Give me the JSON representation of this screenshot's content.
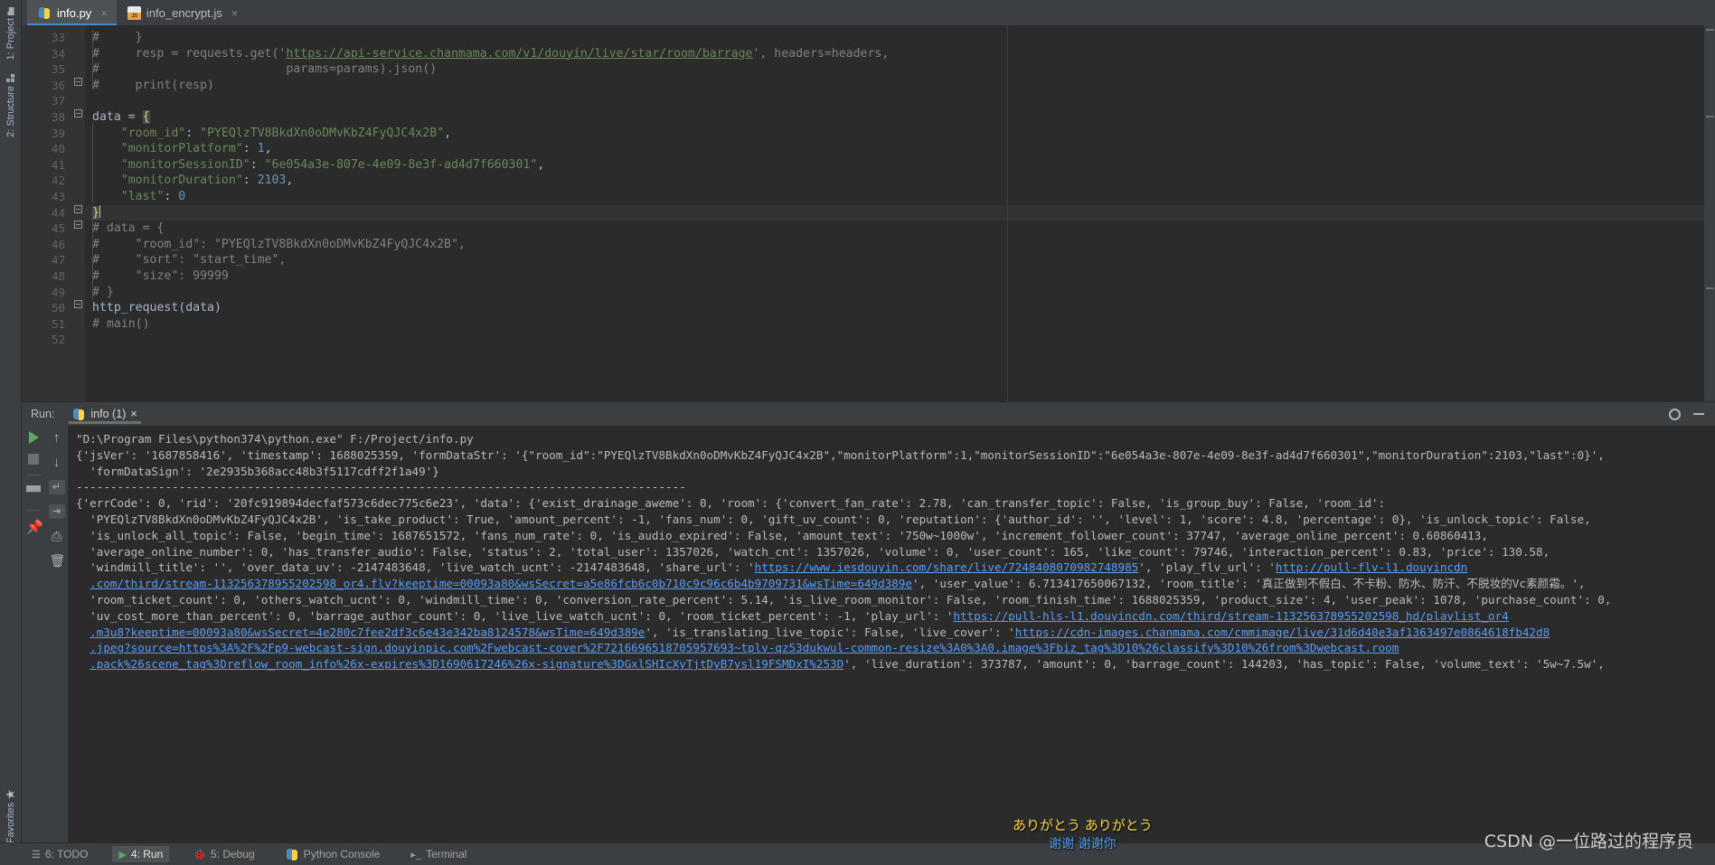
{
  "tabs": [
    {
      "label": "info.py",
      "icon": "python-file-icon",
      "active": true,
      "close": "×"
    },
    {
      "label": "info_encrypt.js",
      "icon": "javascript-file-icon",
      "active": false,
      "close": "×"
    }
  ],
  "left_strip": {
    "project": "1: Project",
    "structure": "2: Structure",
    "favorites": "2: Favorites"
  },
  "editor": {
    "first_line_number": 33,
    "lines": [
      {
        "n": 33,
        "segs": [
          {
            "t": "#     }",
            "c": "cmt"
          }
        ]
      },
      {
        "n": 34,
        "segs": [
          {
            "t": "#     resp = requests.get('",
            "c": "cmt"
          },
          {
            "t": "https://api-service.chanmama.com/v1/douyin/live/star/room/barrage",
            "c": "link"
          },
          {
            "t": "', headers=headers,",
            "c": "cmt"
          }
        ]
      },
      {
        "n": 35,
        "segs": [
          {
            "t": "#                          params=params).json()",
            "c": "cmt"
          }
        ]
      },
      {
        "n": 36,
        "segs": [
          {
            "t": "#     print(resp)",
            "c": "cmt"
          }
        ]
      },
      {
        "n": 37,
        "segs": [
          {
            "t": "",
            "c": "punc"
          }
        ]
      },
      {
        "n": 38,
        "segs": [
          {
            "t": "data = ",
            "c": "punc"
          },
          {
            "t": "{",
            "c": "brace-hl"
          }
        ]
      },
      {
        "n": 39,
        "segs": [
          {
            "t": "    ",
            "c": "punc"
          },
          {
            "t": "\"room_id\"",
            "c": "str"
          },
          {
            "t": ": ",
            "c": "punc"
          },
          {
            "t": "\"PYEQlzTV8BkdXn0oDMvKbZ4FyQJC4x2B\"",
            "c": "str"
          },
          {
            "t": ",",
            "c": "punc"
          }
        ]
      },
      {
        "n": 40,
        "segs": [
          {
            "t": "    ",
            "c": "punc"
          },
          {
            "t": "\"monitorPlatform\"",
            "c": "str"
          },
          {
            "t": ": ",
            "c": "punc"
          },
          {
            "t": "1",
            "c": "num"
          },
          {
            "t": ",",
            "c": "punc"
          }
        ]
      },
      {
        "n": 41,
        "segs": [
          {
            "t": "    ",
            "c": "punc"
          },
          {
            "t": "\"monitorSessionID\"",
            "c": "str"
          },
          {
            "t": ": ",
            "c": "punc"
          },
          {
            "t": "\"6e054a3e-807e-4e09-8e3f-ad4d7f660301\"",
            "c": "str"
          },
          {
            "t": ",",
            "c": "punc"
          }
        ]
      },
      {
        "n": 42,
        "segs": [
          {
            "t": "    ",
            "c": "punc"
          },
          {
            "t": "\"monitorDuration\"",
            "c": "str"
          },
          {
            "t": ": ",
            "c": "punc"
          },
          {
            "t": "2103",
            "c": "num"
          },
          {
            "t": ",",
            "c": "punc"
          }
        ]
      },
      {
        "n": 43,
        "segs": [
          {
            "t": "    ",
            "c": "punc"
          },
          {
            "t": "\"last\"",
            "c": "str"
          },
          {
            "t": ": ",
            "c": "punc"
          },
          {
            "t": "0",
            "c": "num"
          }
        ]
      },
      {
        "n": 44,
        "segs": [
          {
            "t": "}",
            "c": "brace-hl"
          }
        ],
        "cursor": true,
        "current": true
      },
      {
        "n": 45,
        "segs": [
          {
            "t": "# data = {",
            "c": "cmt"
          }
        ]
      },
      {
        "n": 46,
        "segs": [
          {
            "t": "#     \"room_id\": \"PYEQlzTV8BkdXn0oDMvKbZ4FyQJC4x2B\",",
            "c": "cmt"
          }
        ]
      },
      {
        "n": 47,
        "segs": [
          {
            "t": "#     \"sort\": \"start_time\",",
            "c": "cmt"
          }
        ]
      },
      {
        "n": 48,
        "segs": [
          {
            "t": "#     \"size\": 99999",
            "c": "cmt"
          }
        ]
      },
      {
        "n": 49,
        "segs": [
          {
            "t": "# }",
            "c": "cmt"
          }
        ]
      },
      {
        "n": 50,
        "segs": [
          {
            "t": "http_request(data)",
            "c": "punc"
          }
        ]
      },
      {
        "n": 51,
        "segs": [
          {
            "t": "# main()",
            "c": "cmt"
          }
        ]
      },
      {
        "n": 52,
        "segs": [
          {
            "t": "",
            "c": "punc"
          }
        ]
      }
    ]
  },
  "run_panel": {
    "run_label": "Run:",
    "tab_label": "info (1)",
    "tab_close": "×",
    "gear_icon": "settings-gear-icon",
    "minimize_icon": "minimize-icon",
    "toolbar_left": [
      {
        "name": "rerun-button",
        "glyph": ""
      },
      {
        "name": "stop-button",
        "glyph": ""
      },
      {
        "name": "layout-button",
        "glyph": ""
      },
      {
        "name": "pin-tab-button",
        "glyph": "📌"
      }
    ],
    "toolbar_right": [
      {
        "name": "up-arrow-button",
        "glyph": "↑"
      },
      {
        "name": "down-arrow-button",
        "glyph": "↓"
      },
      {
        "name": "soft-wrap-button",
        "glyph": "↵"
      },
      {
        "name": "scroll-to-end-button",
        "glyph": "⇥"
      },
      {
        "name": "print-button",
        "glyph": "⎙"
      },
      {
        "name": "clear-all-button",
        "glyph": "🗑"
      }
    ],
    "console_lines": [
      {
        "segs": [
          {
            "t": "\"D:\\Program Files\\python374\\python.exe\" F:/Project/info.py",
            "c": ""
          }
        ]
      },
      {
        "segs": [
          {
            "t": "{'jsVer': '1687858416', 'timestamp': 1688025359, 'formDataStr': '{\"room_id\":\"PYEQlzTV8BkdXn0oDMvKbZ4FyQJC4x2B\",\"monitorPlatform\":1,\"monitorSessionID\":\"6e054a3e-807e-4e09-8e3f-ad4d7f660301\",\"monitorDuration\":2103,\"last\":0}',",
            "c": ""
          }
        ]
      },
      {
        "segs": [
          {
            "t": "  'formDataSign': '2e2935b368acc48b3f5117cdff2f1a49'}",
            "c": ""
          }
        ]
      },
      {
        "segs": [
          {
            "t": "-----------------------------------------------------------------------------------------",
            "c": ""
          }
        ]
      },
      {
        "segs": [
          {
            "t": "{'errCode': 0, 'rid': '20fc919894decfaf573c6dec775c6e23', 'data': {'exist_drainage_aweme': 0, 'room': {'convert_fan_rate': 2.78, 'can_transfer_topic': False, 'is_group_buy': False, 'room_id':",
            "c": ""
          }
        ]
      },
      {
        "segs": [
          {
            "t": "  'PYEQlzTV8BkdXn0oDMvKbZ4FyQJC4x2B', 'is_take_product': True, 'amount_percent': -1, 'fans_num': 0, 'gift_uv_count': 0, 'reputation': {'author_id': '', 'level': 1, 'score': 4.8, 'percentage': 0}, 'is_unlock_topic': False,",
            "c": ""
          }
        ]
      },
      {
        "segs": [
          {
            "t": "  'is_unlock_all_topic': False, 'begin_time': 1687651572, 'fans_num_rate': 0, 'is_audio_expired': False, 'amount_text': '750w~1000w', 'increment_follower_count': 37747, 'average_online_percent': 0.60860413,",
            "c": ""
          }
        ]
      },
      {
        "segs": [
          {
            "t": "  'average_online_number': 0, 'has_transfer_audio': False, 'status': 2, 'total_user': 1357026, 'watch_cnt': 1357026, 'volume': 0, 'user_count': 165, 'like_count': 79746, 'interaction_percent': 0.83, 'price': 130.58,",
            "c": ""
          }
        ]
      },
      {
        "segs": [
          {
            "t": "  'windmill_title': '', 'over_data_uv': -2147483648, 'live_watch_ucnt': -2147483648, 'share_url': '",
            "c": ""
          },
          {
            "t": "https://www.iesdouyin.com/share/live/7248408070982748985",
            "c": "ulink"
          },
          {
            "t": "', 'play_flv_url': '",
            "c": ""
          },
          {
            "t": "http://pull-flv-l1.douyincdn",
            "c": "ulink"
          }
        ]
      },
      {
        "segs": [
          {
            "t": "  ",
            "c": ""
          },
          {
            "t": ".com/third/stream-113256378955202598_or4.flv?keeptime=00093a80&wsSecret=a5e86fcb6c0b710c9c96c6b4b9709731&wsTime=649d389e",
            "c": "ulink"
          },
          {
            "t": "', 'user_value': 6.713417650067132, 'room_title': '真正做到不假白、不卡粉、防水、防汗、不脱妆的Vc素颜霜。', ",
            "c": ""
          }
        ]
      },
      {
        "segs": [
          {
            "t": "  'room_ticket_count': 0, 'others_watch_ucnt': 0, 'windmill_time': 0, 'conversion_rate_percent': 5.14, 'is_live_room_monitor': False, 'room_finish_time': 1688025359, 'product_size': 4, 'user_peak': 1078, 'purchase_count': 0,",
            "c": ""
          }
        ]
      },
      {
        "segs": [
          {
            "t": "  'uv_cost_more_than_percent': 0, 'barrage_author_count': 0, 'live_live_watch_ucnt': 0, 'room_ticket_percent': -1, 'play_url': '",
            "c": ""
          },
          {
            "t": "https://pull-hls-l1.douyincdn.com/third/stream-113256378955202598_hd/playlist_or4",
            "c": "ulink"
          }
        ]
      },
      {
        "segs": [
          {
            "t": "  ",
            "c": ""
          },
          {
            "t": ".m3u8?keeptime=00093a80&wsSecret=4e280c7fee2df3c6e43e342ba8124578&wsTime=649d389e",
            "c": "ulink"
          },
          {
            "t": "', 'is_translating_live_topic': False, 'live_cover': '",
            "c": ""
          },
          {
            "t": "https://cdn-images.chanmama.com/cmmimage/live/31d6d40e3af1363497e0864618fb42d8",
            "c": "ulink"
          }
        ]
      },
      {
        "segs": [
          {
            "t": "  ",
            "c": ""
          },
          {
            "t": ".jpeg?source=https%3A%2F%2Fp9-webcast-sign.douyinpic.com%2Fwebcast-cover%2F7216696518705957693~tplv-qz53dukwul-common-resize%3A0%3A0.image%3Fbiz_tag%3D10%26classify%3D10%26from%3Dwebcast.room",
            "c": "ulink"
          }
        ]
      },
      {
        "segs": [
          {
            "t": "  ",
            "c": ""
          },
          {
            "t": ".pack%26scene_tag%3Dreflow_room_info%26x-expires%3D1690617246%26x-signature%3DGxlSHIcXyTjtDyB7ysl19FSMDxI%253D",
            "c": "ulink"
          },
          {
            "t": "', 'live_duration': 373787, 'amount': 0, 'barrage_count': 144203, 'has_topic': False, 'volume_text': '5w~7.5w',",
            "c": ""
          }
        ]
      }
    ]
  },
  "danmaku": {
    "line1": "ありがとう ありがとう",
    "line2": "谢谢 谢谢你"
  },
  "watermark": "CSDN @一位路过的程序员",
  "status_bar": [
    {
      "label": "6: TODO",
      "icon": "todo-list-icon",
      "glyph": "☰",
      "active": false
    },
    {
      "label": "4: Run",
      "icon": "run-icon",
      "glyph": "▶",
      "active": true
    },
    {
      "label": "5: Debug",
      "icon": "debug-bug-icon",
      "glyph": "🐞",
      "active": false
    },
    {
      "label": "Python Console",
      "icon": "python-console-icon",
      "glyph": "",
      "active": false
    },
    {
      "label": "Terminal",
      "icon": "terminal-icon",
      "glyph": "▸_",
      "active": false
    }
  ],
  "colors": {
    "background": "#2b2b2b",
    "chrome": "#3c3f41",
    "accent": "#4a88c7",
    "string": "#6a8759",
    "number": "#6897bb",
    "comment": "#808080",
    "link": "#589df6"
  }
}
